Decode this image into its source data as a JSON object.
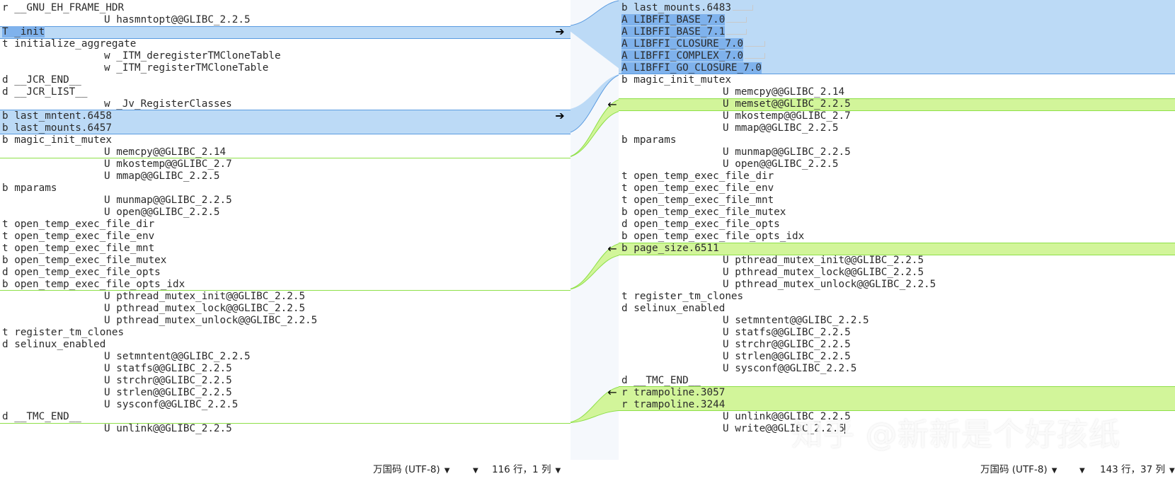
{
  "colors": {
    "move_block": "#bcdaf6",
    "move_selection": "#7fb2ec",
    "insert_block": "#d2f59a",
    "gutter": "#f5f8fc"
  },
  "left_pane": {
    "lines": [
      "r __GNU_EH_FRAME_HDR",
      "U hasmntopt@@GLIBC_2.2.5",
      "T _init",
      "t initialize_aggregate",
      "w _ITM_deregisterTMCloneTable",
      "w _ITM_registerTMCloneTable",
      "d __JCR_END__",
      "d __JCR_LIST__",
      "w _Jv_RegisterClasses",
      "b last_mntent.6458",
      "b last_mounts.6457",
      "b magic_init_mutex",
      "U memcpy@@GLIBC_2.14",
      "U mkostemp@@GLIBC_2.7",
      "U mmap@@GLIBC_2.2.5",
      "b mparams",
      "U munmap@@GLIBC_2.2.5",
      "U open@@GLIBC_2.2.5",
      "t open_temp_exec_file_dir",
      "t open_temp_exec_file_env",
      "t open_temp_exec_file_mnt",
      "b open_temp_exec_file_mutex",
      "d open_temp_exec_file_opts",
      "b open_temp_exec_file_opts_idx",
      "U pthread_mutex_init@@GLIBC_2.2.5",
      "U pthread_mutex_lock@@GLIBC_2.2.5",
      "U pthread_mutex_unlock@@GLIBC_2.2.5",
      "t register_tm_clones",
      "d selinux_enabled",
      "U setmntent@@GLIBC_2.2.5",
      "U statfs@@GLIBC_2.2.5",
      "U strchr@@GLIBC_2.2.5",
      "U strlen@@GLIBC_2.2.5",
      "U sysconf@@GLIBC_2.2.5",
      "d __TMC_END__",
      "U unlink@@GLIBC_2.2.5"
    ]
  },
  "right_pane": {
    "lines": [
      "b last_mounts.6483",
      "A LIBFFI_BASE_7.0",
      "A LIBFFI_BASE_7.1",
      "A LIBFFI_CLOSURE_7.0",
      "A LIBFFI_COMPLEX_7.0",
      "A LIBFFI_GO_CLOSURE_7.0",
      "b magic_init_mutex",
      "U memcpy@@GLIBC_2.14",
      "U memset@@GLIBC_2.2.5",
      "U mkostemp@@GLIBC_2.7",
      "U mmap@@GLIBC_2.2.5",
      "b mparams",
      "U munmap@@GLIBC_2.2.5",
      "U open@@GLIBC_2.2.5",
      "t open_temp_exec_file_dir",
      "t open_temp_exec_file_env",
      "t open_temp_exec_file_mnt",
      "b open_temp_exec_file_mutex",
      "d open_temp_exec_file_opts",
      "b open_temp_exec_file_opts_idx",
      "b page_size.6511",
      "U pthread_mutex_init@@GLIBC_2.2.5",
      "U pthread_mutex_lock@@GLIBC_2.2.5",
      "U pthread_mutex_unlock@@GLIBC_2.2.5",
      "t register_tm_clones",
      "d selinux_enabled",
      "U setmntent@@GLIBC_2.2.5",
      "U statfs@@GLIBC_2.2.5",
      "U strchr@@GLIBC_2.2.5",
      "U strlen@@GLIBC_2.2.5",
      "U sysconf@@GLIBC_2.2.5",
      "d __TMC_END__",
      "r trampoline.3057",
      "r trampoline.3244",
      "U unlink@@GLIBC_2.2.5",
      "U write@@GLIBC_2.2.5"
    ]
  },
  "arrows": {
    "right": "➔",
    "left": "←"
  },
  "watermark": "知乎 @新新是个好孩纸",
  "left_status": {
    "encoding": "万国码 (UTF-8)",
    "position": "116 行，1 列"
  },
  "right_status": {
    "encoding": "万国码 (UTF-8)",
    "position": "143 行，37 列"
  }
}
